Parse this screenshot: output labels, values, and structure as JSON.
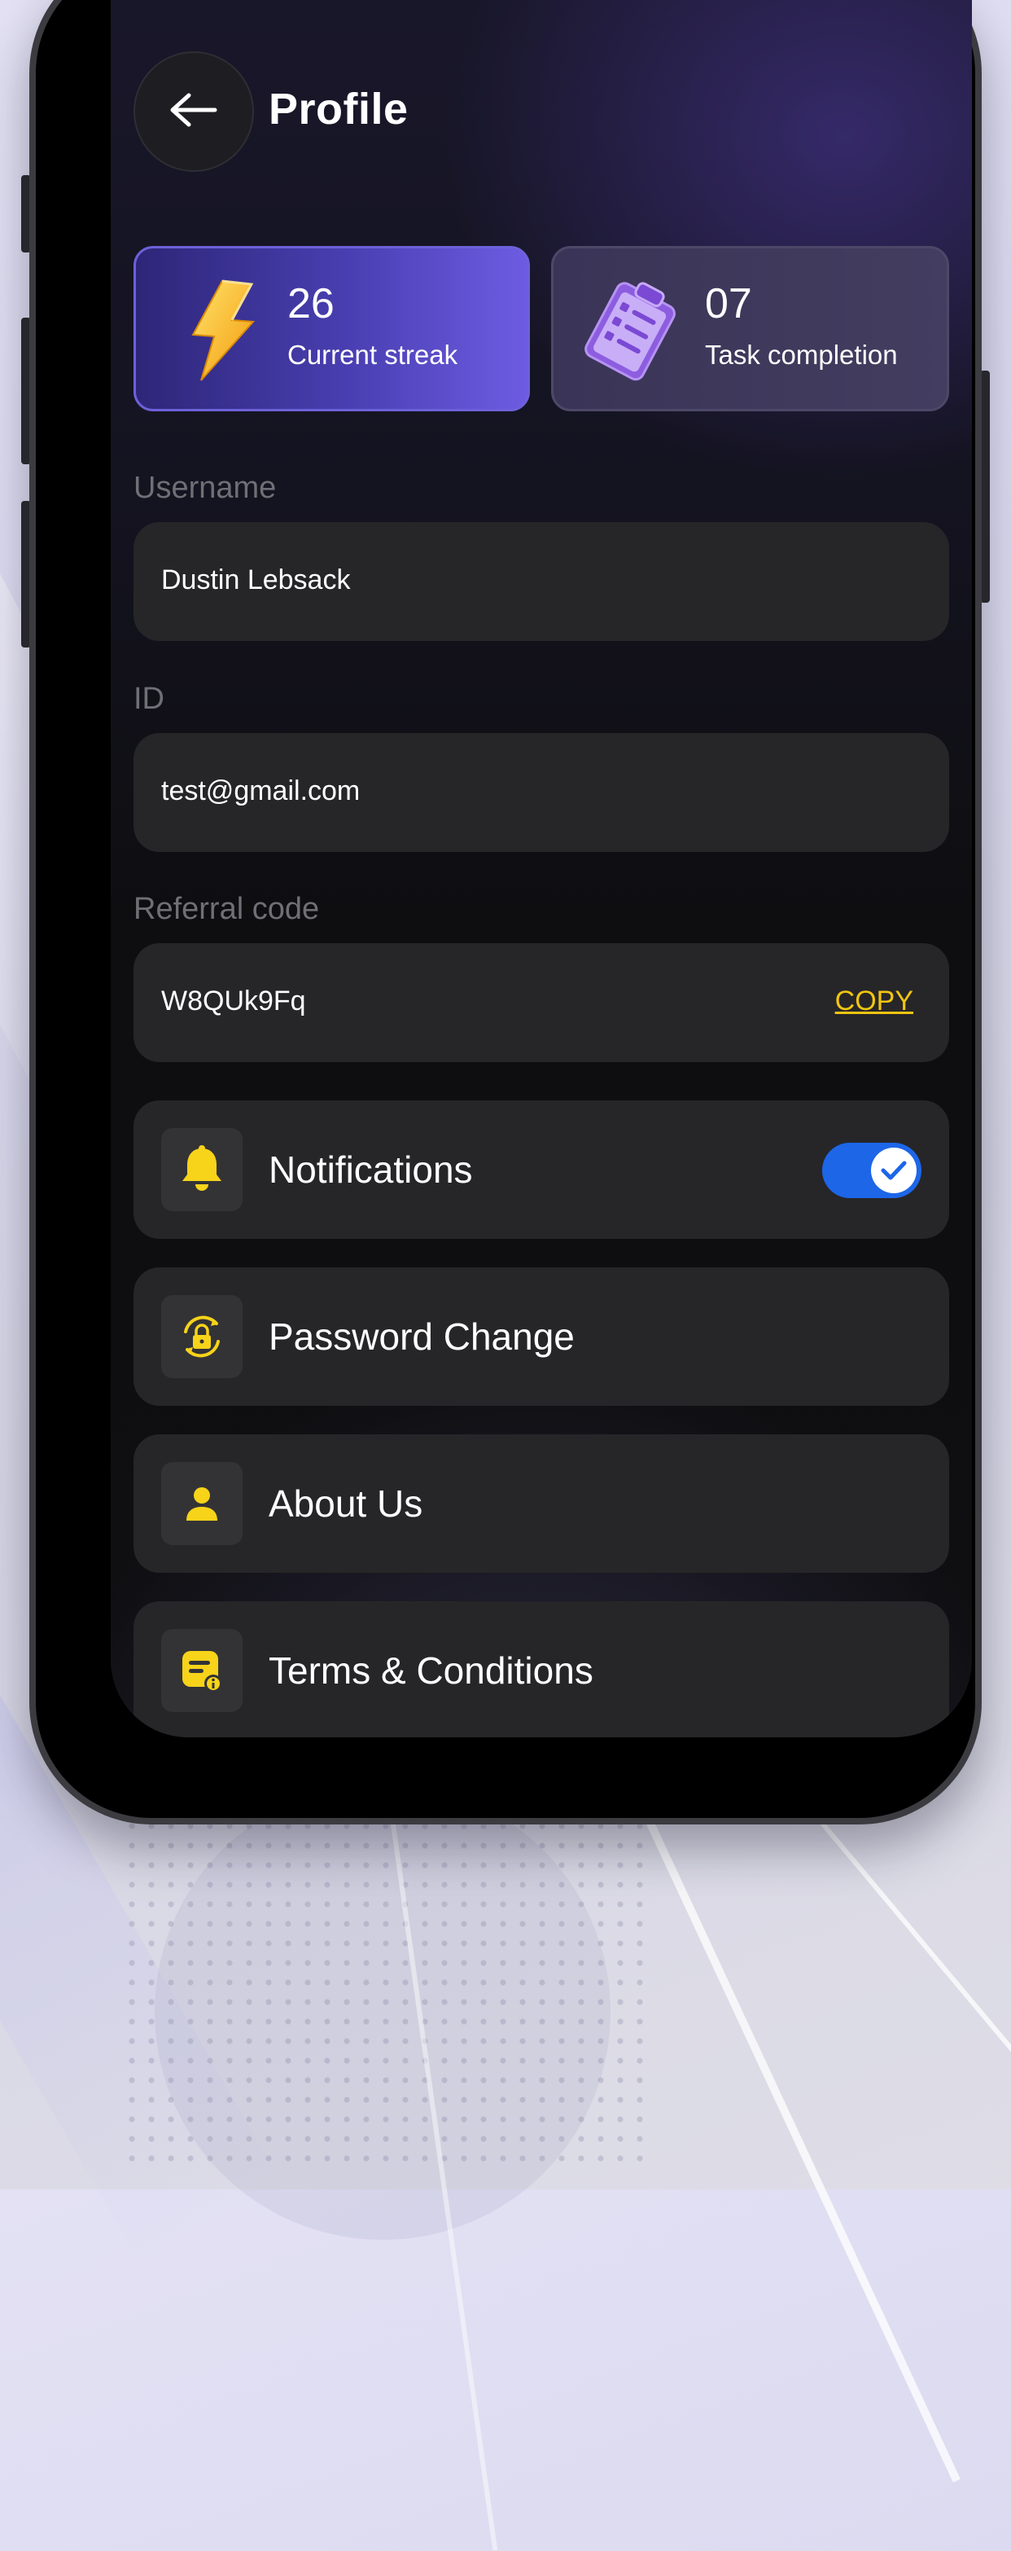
{
  "header": {
    "title": "Profile",
    "back_icon": "arrow-left-icon"
  },
  "stats": [
    {
      "value": "26",
      "label": "Current streak",
      "icon": "lightning-icon"
    },
    {
      "value": "07",
      "label": "Task completion",
      "icon": "clipboard-checklist-icon"
    }
  ],
  "fields": {
    "username": {
      "label": "Username",
      "value": "Dustin Lebsack"
    },
    "id": {
      "label": "ID",
      "value": "test@gmail.com"
    },
    "referral": {
      "label": "Referral code",
      "value": "W8QUk9Fq",
      "action": "COPY"
    }
  },
  "menu": {
    "notifications": {
      "label": "Notifications",
      "icon": "bell-icon",
      "enabled": true
    },
    "password": {
      "label": "Password Change",
      "icon": "lock-refresh-icon"
    },
    "about": {
      "label": "About Us",
      "icon": "person-icon"
    },
    "terms": {
      "label": "Terms & Conditions",
      "icon": "document-info-icon"
    }
  },
  "colors": {
    "accent_yellow": "#f2c511",
    "toggle_blue": "#1d66e8",
    "card_purple": "#5a4bc9"
  }
}
